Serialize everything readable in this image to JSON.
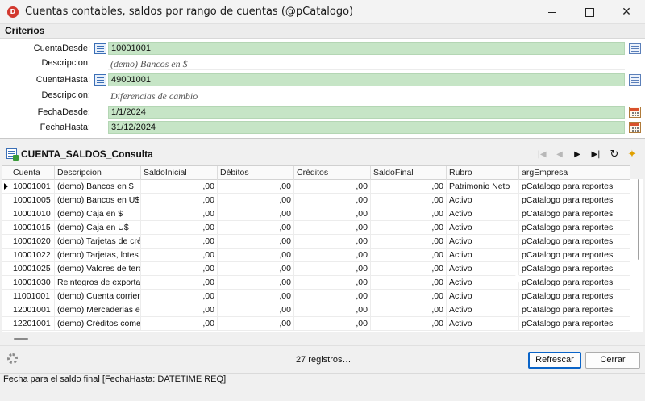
{
  "window": {
    "title": "Cuentas contables, saldos por rango de cuentas (@pCatalogo)",
    "icon_letter": "D"
  },
  "criterios": {
    "header": "Criterios",
    "fields": [
      {
        "label": "CuentaDesde:",
        "value": "10001001"
      },
      {
        "label": "Descripcion:",
        "value": "(demo) Bancos en $"
      },
      {
        "label": "CuentaHasta:",
        "value": "49001001"
      },
      {
        "label": "Descripcion:",
        "value": "Diferencias de cambio"
      },
      {
        "label": "FechaDesde:",
        "value": "1/1/2024"
      },
      {
        "label": "FechaHasta:",
        "value": "31/12/2024"
      }
    ]
  },
  "panel": {
    "title": "CUENTA_SALDOS_Consulta"
  },
  "grid": {
    "columns": [
      "Cuenta",
      "Descripcion",
      "SaldoInicial",
      "Débitos",
      "Créditos",
      "SaldoFinal",
      "Rubro",
      "argEmpresa"
    ],
    "rows": [
      [
        "10001001",
        "(demo) Bancos en $",
        ",00",
        ",00",
        ",00",
        ",00",
        "Patrimonio Neto",
        "pCatalogo para reportes"
      ],
      [
        "10001005",
        "(demo) Bancos en U$",
        ",00",
        ",00",
        ",00",
        ",00",
        "Activo",
        "pCatalogo para reportes"
      ],
      [
        "10001010",
        "(demo) Caja en $",
        ",00",
        ",00",
        ",00",
        ",00",
        "Activo",
        "pCatalogo para reportes"
      ],
      [
        "10001015",
        "(demo) Caja en U$",
        ",00",
        ",00",
        ",00",
        ",00",
        "Activo",
        "pCatalogo para reportes"
      ],
      [
        "10001020",
        "(demo) Tarjetas de cré",
        ",00",
        ",00",
        ",00",
        ",00",
        "Activo",
        "pCatalogo para reportes"
      ],
      [
        "10001022",
        "(demo) Tarjetas, lotes",
        ",00",
        ",00",
        ",00",
        ",00",
        "Activo",
        "pCatalogo para reportes"
      ],
      [
        "10001025",
        "(demo) Valores de terc",
        ",00",
        ",00",
        ",00",
        ",00",
        "Activo",
        "pCatalogo para reportes"
      ],
      [
        "10001030",
        "Reintegros de exportac",
        ",00",
        ",00",
        ",00",
        ",00",
        "Activo",
        "pCatalogo para reportes"
      ],
      [
        "11001001",
        "(demo) Cuenta corrient",
        ",00",
        ",00",
        ",00",
        ",00",
        "Activo",
        "pCatalogo para reportes"
      ],
      [
        "12001001",
        "(demo) Mercaderias en",
        ",00",
        ",00",
        ",00",
        ",00",
        "Activo",
        "pCatalogo para reportes"
      ],
      [
        "12201001",
        "(demo) Créditos comerc",
        ",00",
        ",00",
        ",00",
        ",00",
        "Activo",
        "pCatalogo para reportes"
      ]
    ]
  },
  "footer": {
    "count": "27 registros…",
    "refresh_label": "Refrescar",
    "close_label": "Cerrar"
  },
  "status": {
    "text": "Fecha para el saldo final [FechaHasta: DATETIME REQ]"
  }
}
